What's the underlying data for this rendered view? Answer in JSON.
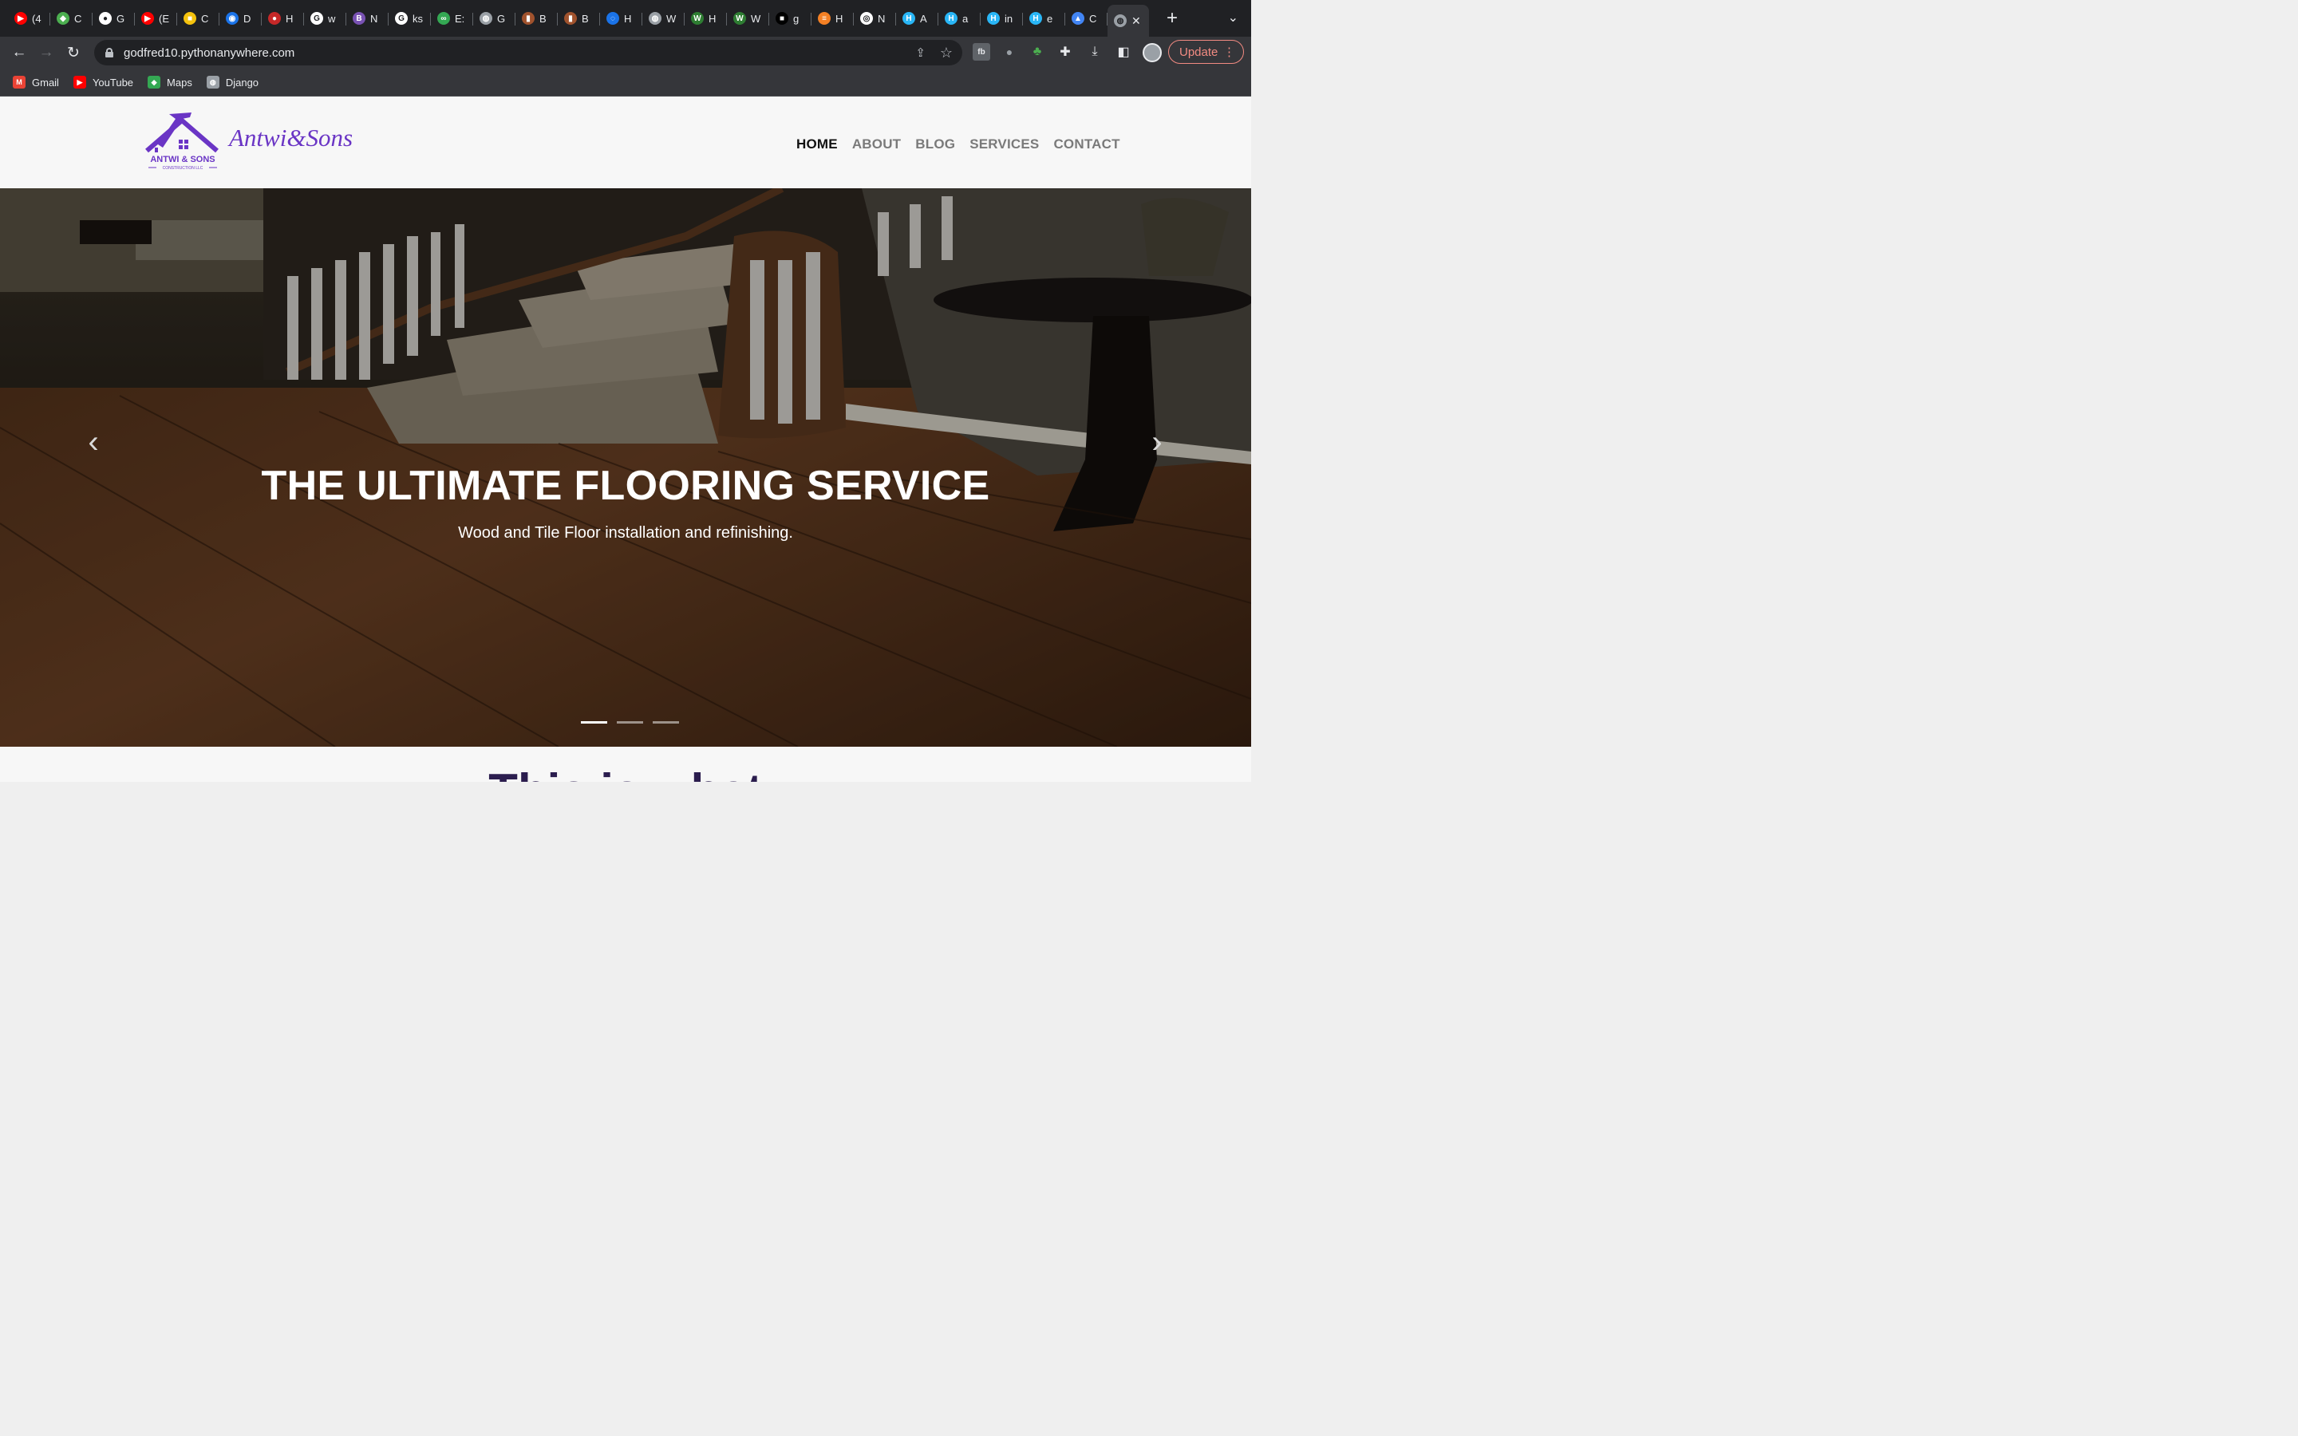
{
  "browser": {
    "tabs": [
      {
        "label": "(4",
        "icon": "youtube-icon",
        "color": "#ff0000",
        "glyph": "▶"
      },
      {
        "label": "C",
        "icon": "diamond-icon",
        "color": "#4caf50",
        "glyph": "◆"
      },
      {
        "label": "G",
        "icon": "github-icon",
        "color": "#ffffff",
        "glyph": "●"
      },
      {
        "label": "(E",
        "icon": "youtube-icon",
        "color": "#ff0000",
        "glyph": "▶"
      },
      {
        "label": "C",
        "icon": "badge-icon",
        "color": "#f4c20d",
        "glyph": "■"
      },
      {
        "label": "D",
        "icon": "owl-icon",
        "color": "#1a73e8",
        "glyph": "◉"
      },
      {
        "label": "H",
        "icon": "pin-icon",
        "color": "#c62828",
        "glyph": "●"
      },
      {
        "label": "w",
        "icon": "google-icon",
        "color": "#ffffff",
        "glyph": "G"
      },
      {
        "label": "N",
        "icon": "bootstrap-icon",
        "color": "#7952b3",
        "glyph": "B"
      },
      {
        "label": "ks",
        "icon": "google-icon",
        "color": "#ffffff",
        "glyph": "G"
      },
      {
        "label": "E:",
        "icon": "link-icon",
        "color": "#34a853",
        "glyph": "∞"
      },
      {
        "label": "G",
        "icon": "globe-icon",
        "color": "#9aa0a6",
        "glyph": "◍"
      },
      {
        "label": "B",
        "icon": "book-icon",
        "color": "#a0522d",
        "glyph": "▮"
      },
      {
        "label": "B",
        "icon": "book-icon",
        "color": "#a0522d",
        "glyph": "▮"
      },
      {
        "label": "H",
        "icon": "spinner-icon",
        "color": "#1a73e8",
        "glyph": "◌"
      },
      {
        "label": "W",
        "icon": "globe-icon",
        "color": "#9aa0a6",
        "glyph": "◍"
      },
      {
        "label": "H",
        "icon": "w-icon",
        "color": "#2e7d32",
        "glyph": "W"
      },
      {
        "label": "W",
        "icon": "w-icon",
        "color": "#2e7d32",
        "glyph": "W"
      },
      {
        "label": "g",
        "icon": "dark-icon",
        "color": "#000000",
        "glyph": "■"
      },
      {
        "label": "H",
        "icon": "stack-icon",
        "color": "#f48024",
        "glyph": "≡"
      },
      {
        "label": "N",
        "icon": "chrome-icon",
        "color": "#ffffff",
        "glyph": "◎"
      },
      {
        "label": "A",
        "icon": "h-icon",
        "color": "#29b6f6",
        "glyph": "H"
      },
      {
        "label": "a",
        "icon": "h-icon",
        "color": "#29b6f6",
        "glyph": "H"
      },
      {
        "label": "in",
        "icon": "h-icon",
        "color": "#29b6f6",
        "glyph": "H"
      },
      {
        "label": "e",
        "icon": "h-icon",
        "color": "#29b6f6",
        "glyph": "H"
      },
      {
        "label": "C",
        "icon": "triangle-icon",
        "color": "#4285f4",
        "glyph": "▲"
      }
    ],
    "active_tab_icon": "globe-icon",
    "url": "godfred10.pythonanywhere.com",
    "update_label": "Update",
    "bookmarks": [
      {
        "label": "Gmail",
        "icon": "gmail-icon",
        "color": "#ea4335",
        "glyph": "M"
      },
      {
        "label": "YouTube",
        "icon": "youtube-icon",
        "color": "#ff0000",
        "glyph": "▶"
      },
      {
        "label": "Maps",
        "icon": "maps-icon",
        "color": "#34a853",
        "glyph": "◆"
      },
      {
        "label": "Django",
        "icon": "globe-icon",
        "color": "#9aa0a6",
        "glyph": "◍"
      }
    ]
  },
  "site": {
    "brand": "Antwi&Sons",
    "logo_text": "ANTWI & SONS",
    "logo_subtext": "CONSTRUCTION LLC",
    "nav": [
      "HOME",
      "ABOUT",
      "BLOG",
      "SERVICES",
      "CONTACT"
    ],
    "active_nav": "HOME",
    "accent_color": "#6a35c5",
    "hero": {
      "title": "THE ULTIMATE FLOORING SERVICE",
      "subtitle": "Wood and Tile Floor installation and refinishing.",
      "slides": 3,
      "active_slide": 1
    },
    "section_heading_partial": "This..."
  }
}
